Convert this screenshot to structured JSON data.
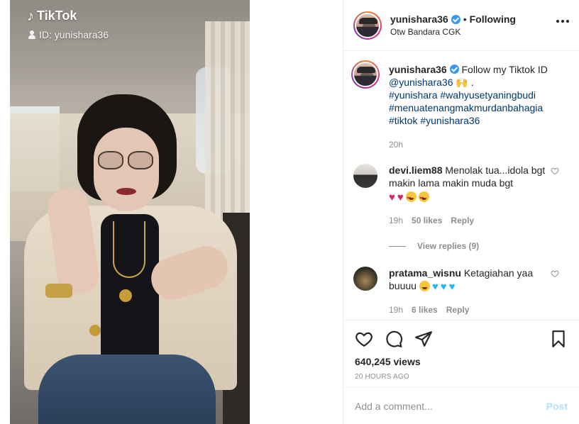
{
  "media": {
    "overlay_logo": "TikTok",
    "overlay_id": "ID: yunishara36"
  },
  "post": {
    "username": "yunishara36",
    "separator": "•",
    "follow_state": "Following",
    "location": "Otw Bandara CGK",
    "caption_text": "Follow my Tiktok ID",
    "caption_mention": "@yunishara36",
    "caption_emoji": "🙌 .",
    "hashtags": [
      "#yunishara",
      "#wahyusetyaningbudi",
      "#menuatenangmakmurdanbahagia",
      "#tiktok",
      "#yunishara36"
    ],
    "caption_time": "20h"
  },
  "comments": [
    {
      "username": "devi.liem88",
      "text": "Menolak tua...idola bgt makin lama makin muda bgt",
      "time": "19h",
      "likes": "50 likes",
      "reply_label": "Reply",
      "view_replies": "View replies (9)"
    },
    {
      "username": "pratama_wisnu",
      "text": "Ketagiahan yaa buuuu",
      "time": "19h",
      "likes": "6 likes",
      "reply_label": "Reply"
    }
  ],
  "stats": {
    "views": "640,245 views",
    "time_ago": "20 HOURS AGO"
  },
  "composer": {
    "placeholder": "Add a comment...",
    "post_label": "Post"
  },
  "colors": {
    "link": "#00376b",
    "verified": "#3897f0",
    "post_disabled": "#b2dffc",
    "muted": "#8e8e8e"
  }
}
